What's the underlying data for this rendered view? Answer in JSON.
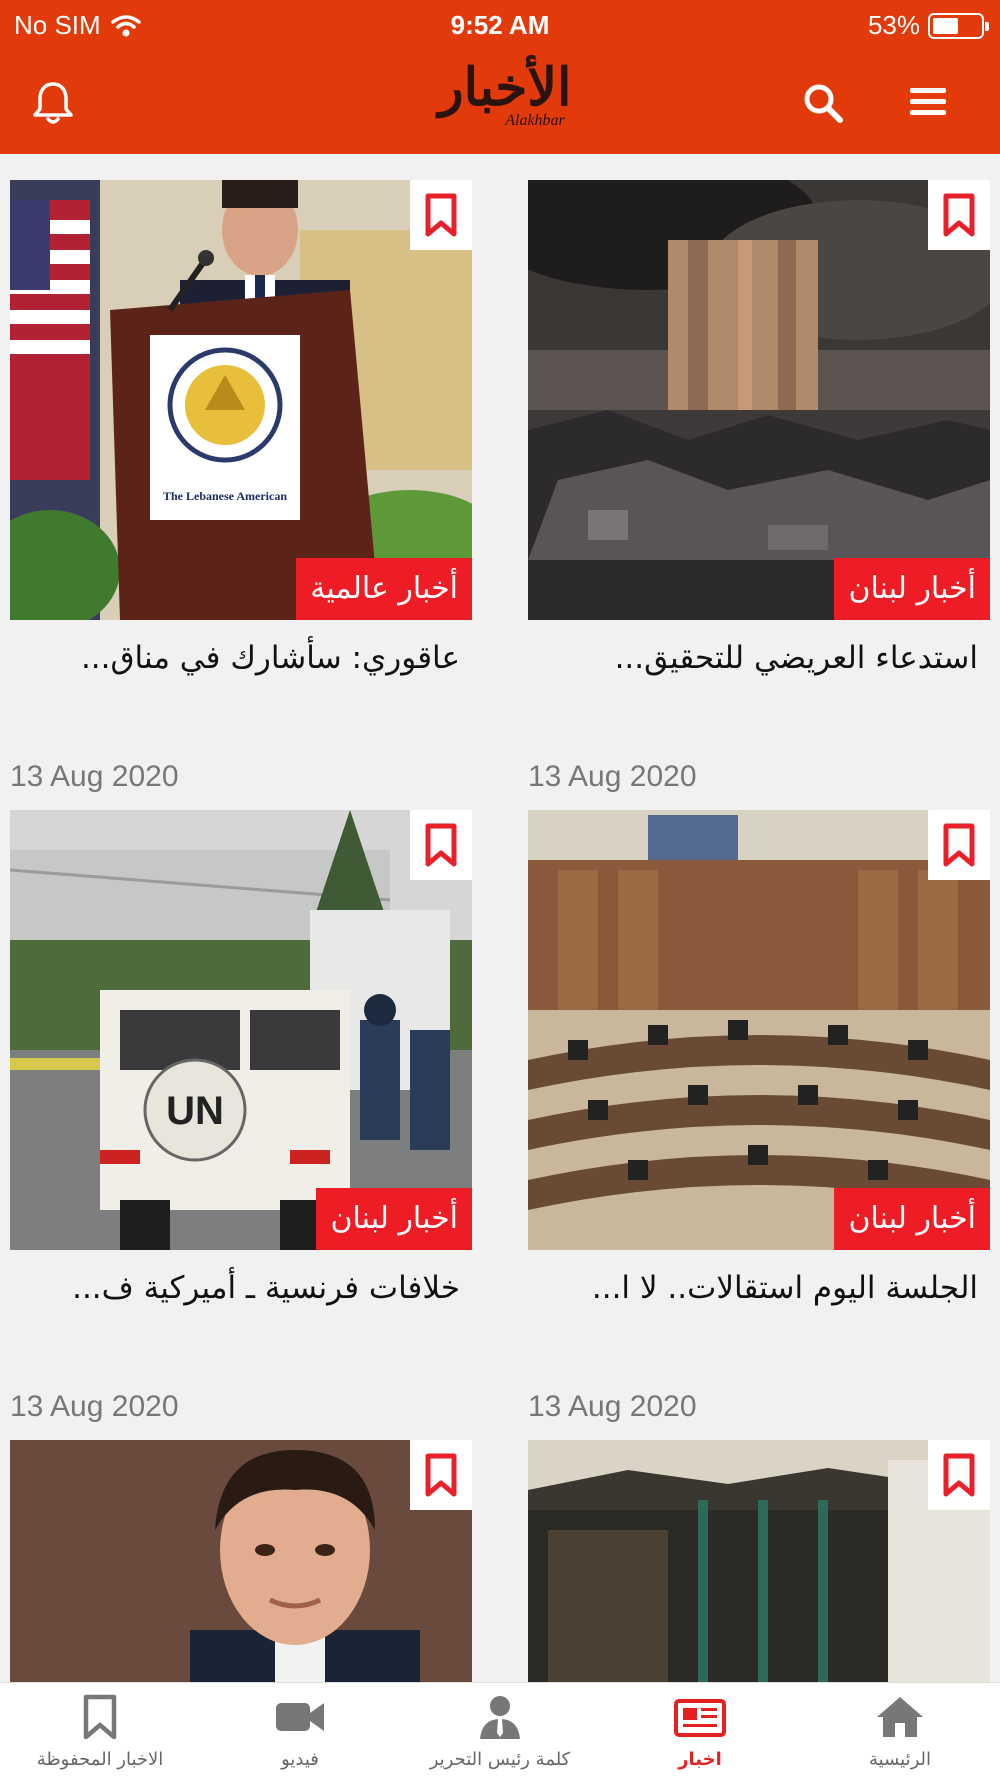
{
  "status_bar": {
    "carrier": "No SIM",
    "time": "9:52 AM",
    "battery_text": "53%",
    "battery_level": 0.53
  },
  "header": {
    "logo_ar": "الأخبار",
    "logo_en": "Alakhbar",
    "brand_color": "#e23a0a",
    "icons": [
      "bell-icon",
      "search-icon",
      "menu-icon"
    ]
  },
  "articles": [
    {
      "category": "أخبار لبنان",
      "headline": "استدعاء العريضي للتحقيق...",
      "date": "13 Aug 2020"
    },
    {
      "category": "أخبار عالمية",
      "headline": "عاقوري: سأشارك في مناق...",
      "date": "13 Aug 2020"
    },
    {
      "category": "أخبار لبنان",
      "headline": "الجلسة اليوم استقالات.. لا ا...",
      "date": "13 Aug 2020"
    },
    {
      "category": "أخبار لبنان",
      "headline": "خلافات فرنسية ـ أميركية ف...",
      "date": "13 Aug 2020"
    },
    {
      "category": "",
      "headline": "",
      "date": ""
    },
    {
      "category": "",
      "headline": "",
      "date": ""
    }
  ],
  "photo_text": {
    "podium_sign": "The Lebanese American",
    "vehicle_mark": "UN"
  },
  "bottom_nav": {
    "items": [
      {
        "label": "الاخبار المحفوظة",
        "icon": "bookmark-icon"
      },
      {
        "label": "فيديو",
        "icon": "video-icon"
      },
      {
        "label": "كلمة رئيس التحرير",
        "icon": "editor-icon"
      },
      {
        "label": "اخبار",
        "icon": "news-icon",
        "active": true
      },
      {
        "label": "الرئيسية",
        "icon": "home-icon"
      }
    ],
    "active_color": "#e62020"
  }
}
